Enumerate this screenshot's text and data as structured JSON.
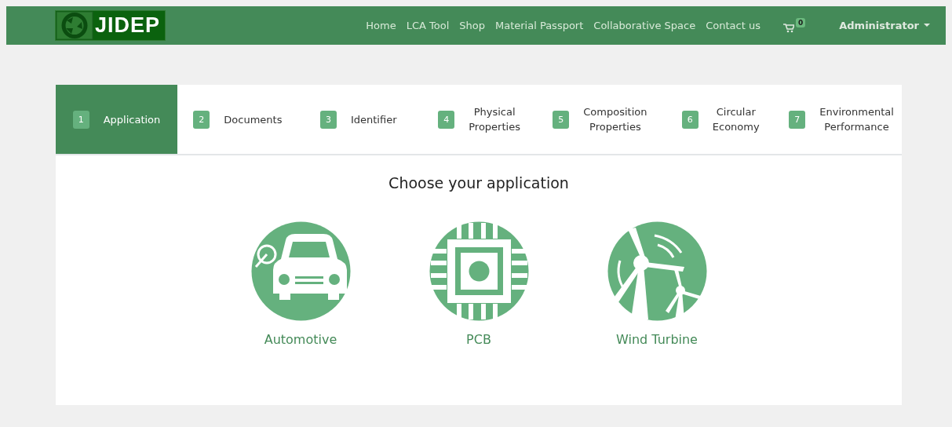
{
  "navbar": {
    "logo": "JIDEP",
    "links": [
      "Home",
      "LCA Tool",
      "Shop",
      "Material Passport",
      "Collaborative Space",
      "Contact us"
    ],
    "cart_count": "0",
    "user": "Administrator"
  },
  "steps": [
    {
      "number": "1",
      "lines": [
        "Application"
      ],
      "selected": true
    },
    {
      "number": "2",
      "lines": [
        "Documents"
      ],
      "selected": false
    },
    {
      "number": "3",
      "lines": [
        "Identifier"
      ],
      "selected": false
    },
    {
      "number": "4",
      "lines": [
        "Physical",
        "Properties"
      ],
      "selected": false
    },
    {
      "number": "5",
      "lines": [
        "Composition",
        "Properties"
      ],
      "selected": false
    },
    {
      "number": "6",
      "lines": [
        "Circular",
        "Economy"
      ],
      "selected": false
    },
    {
      "number": "7",
      "lines": [
        "Environmental",
        "Performance"
      ],
      "selected": false
    }
  ],
  "heading": "Choose your application",
  "applications": [
    {
      "kind": "car",
      "label": "Automotive"
    },
    {
      "kind": "chip",
      "label": "PCB"
    },
    {
      "kind": "turbine",
      "label": "Wind Turbine"
    }
  ]
}
